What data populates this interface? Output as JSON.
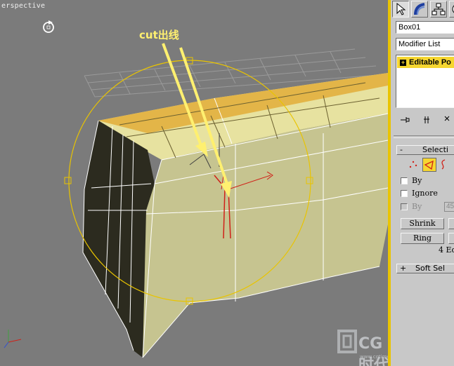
{
  "viewport": {
    "label": "Perspective",
    "label_visible": "erspective",
    "annotation": "cut出线",
    "watermark_text": "CG时代",
    "watermark_url": "www.cgtime.com.cn",
    "colors": {
      "background": "#7b7b7b",
      "selection_yellow": "#e9c400",
      "annotation": "#fff070"
    }
  },
  "command_panel": {
    "tabs": [
      {
        "name": "create-tab",
        "icon": "pointer-icon",
        "active": true
      },
      {
        "name": "modify-tab",
        "icon": "bend-icon",
        "active": false
      },
      {
        "name": "hierarchy-tab",
        "icon": "hierarchy-icon",
        "active": false
      },
      {
        "name": "motion-tab",
        "icon": "circle-icon",
        "active": false
      }
    ],
    "object_name": "Box01",
    "modifier_list_label": "Modifier List",
    "stack_item": "Editable Po",
    "selection_rollout": {
      "sign": "-",
      "title": "Selecti",
      "by_vertex_label": "By",
      "ignore_label": "Ignore",
      "by_angle_label": "By",
      "angle_value": "45",
      "shrink_label": "Shrink",
      "ring_label": "Ring",
      "selection_count": "4 Ed"
    },
    "soft_selection_rollout": {
      "sign": "+",
      "title": "Soft Sel"
    }
  }
}
